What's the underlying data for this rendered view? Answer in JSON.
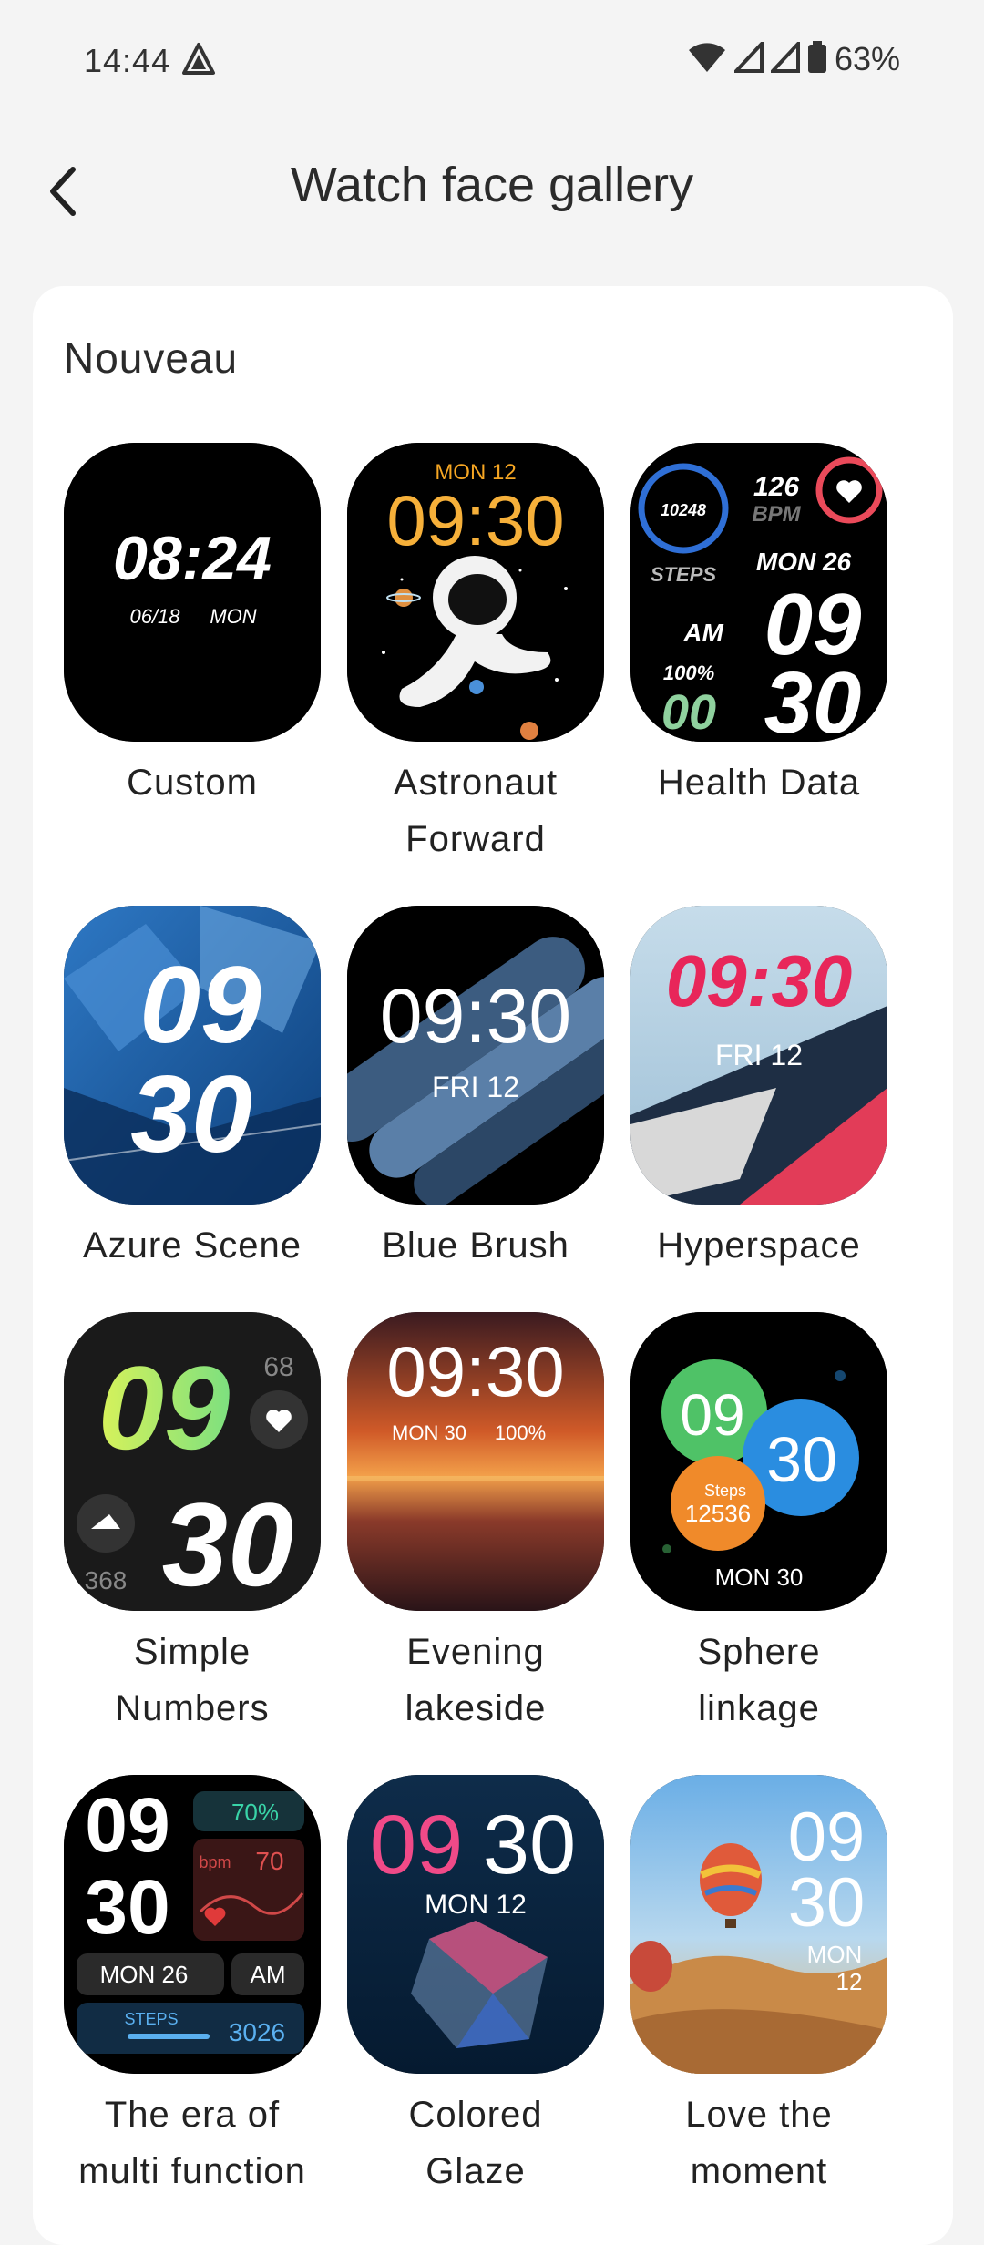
{
  "status_bar": {
    "time": "14:44",
    "battery": "63%"
  },
  "header": {
    "title": "Watch face gallery"
  },
  "section": {
    "title": "Nouveau"
  },
  "faces": [
    {
      "name": "Custom",
      "time": "08:24",
      "date": "06/18",
      "day": "MON"
    },
    {
      "name": "Astronaut\nForward",
      "day": "MON 12",
      "time": "09:30"
    },
    {
      "name": "Health  Data",
      "steps": "10248",
      "steps_label": "STEPS",
      "bpm": "126",
      "bpm_label": "BPM",
      "date": "MON 26",
      "ampm": "AM",
      "battery": "100%",
      "hour": "09",
      "minute": "30",
      "sec": "00"
    },
    {
      "name": "Azure  Scene",
      "hour": "09",
      "minute": "30"
    },
    {
      "name": "Blue  Brush",
      "time": "09:30",
      "day": "FRI  12"
    },
    {
      "name": "Hyperspace",
      "time": "09:30",
      "day": "FRI  12"
    },
    {
      "name": "Simple\nNumbers",
      "hour": "09",
      "minute": "30",
      "bpm": "68",
      "steps": "368"
    },
    {
      "name": "Evening\nlakeside",
      "time": "09:30",
      "date": "MON  30",
      "battery": "100%"
    },
    {
      "name": "Sphere\nlinkage",
      "hour": "09",
      "minute": "30",
      "steps_label": "Steps",
      "steps": "12536",
      "day": "MON 30"
    },
    {
      "name": "The era of\nmulti function",
      "hour": "09",
      "minute": "30",
      "battery": "70%",
      "bpm_label": "bpm",
      "bpm": "70",
      "date": "MON 26",
      "ampm": "AM",
      "steps_label": "STEPS",
      "steps": "3026"
    },
    {
      "name": "Colored\nGlaze",
      "hour": "09",
      "minute": "30",
      "day": "MON 12"
    },
    {
      "name": "Love the\nmoment",
      "hour": "09",
      "minute": "30",
      "day": "MON",
      "date": "12"
    }
  ]
}
